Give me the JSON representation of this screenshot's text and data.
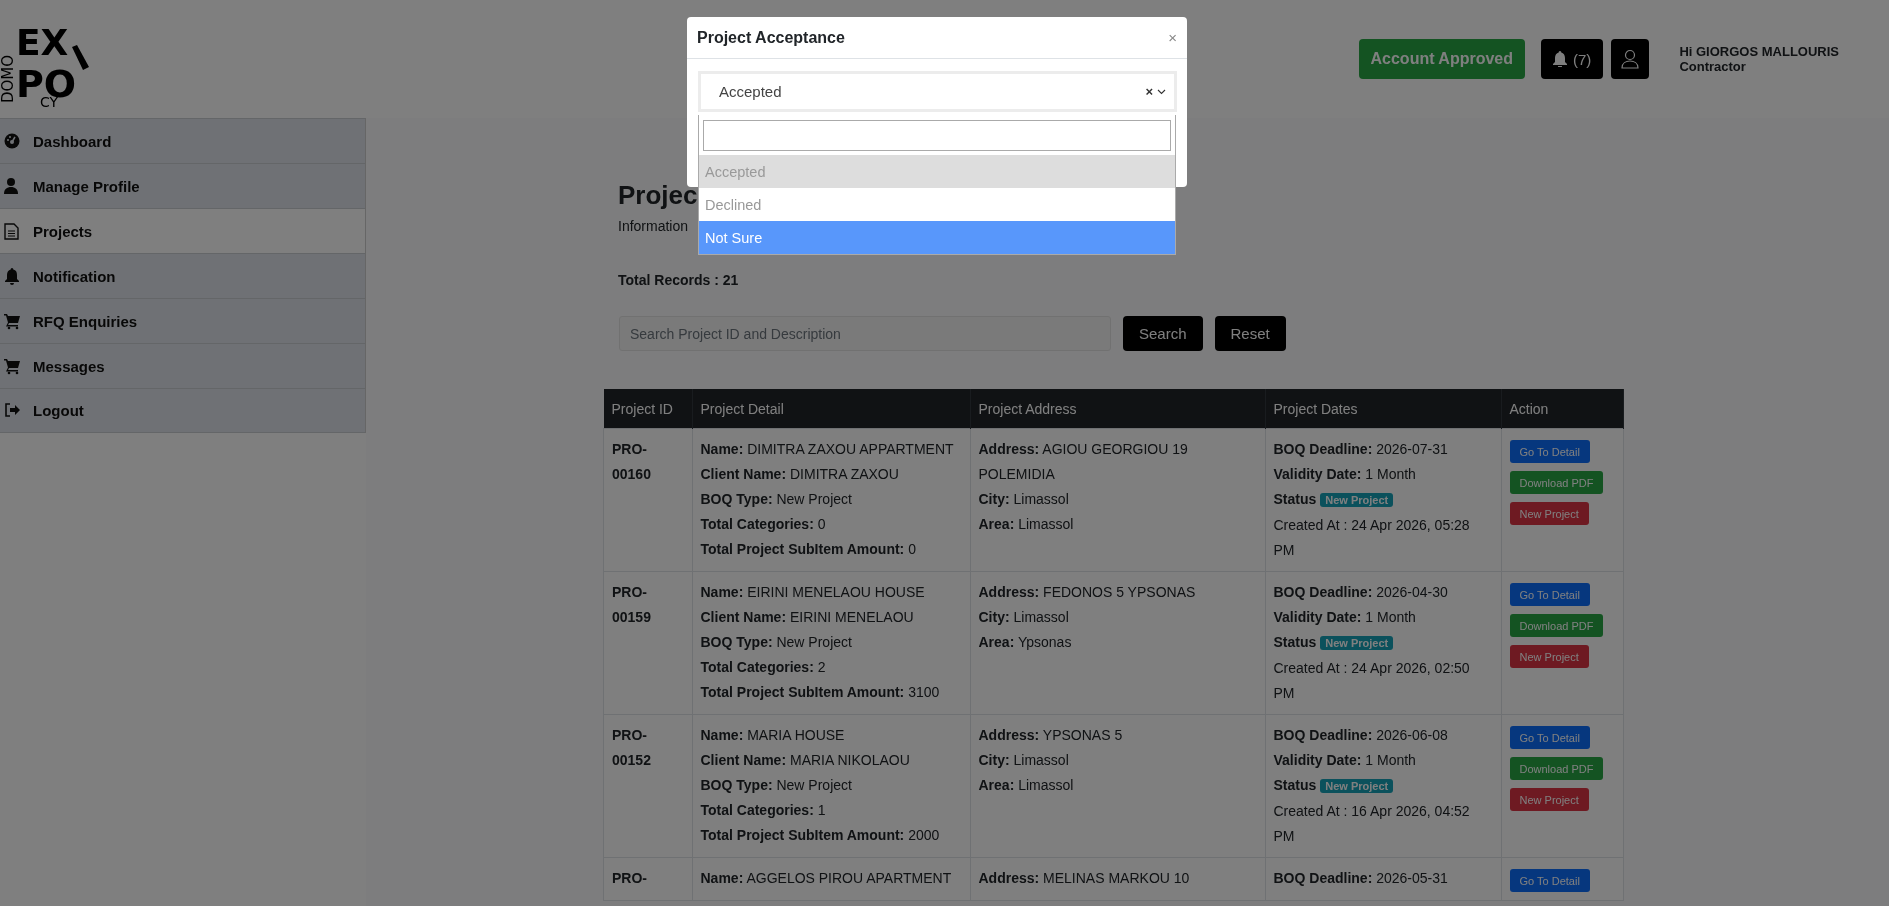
{
  "logo": {
    "vertical": "DOMO",
    "top": "EX",
    "bottom": "PO",
    "small": "CY"
  },
  "header": {
    "account_status": "Account Approved",
    "notifications": "(7)",
    "greeting": "Hi GIORGOS MALLOURIS",
    "role": "Contractor"
  },
  "sidebar": {
    "items": [
      {
        "label": "Dashboard",
        "selected": false
      },
      {
        "label": "Manage Profile",
        "selected": false
      },
      {
        "label": "Projects",
        "selected": true
      },
      {
        "label": "Notification",
        "selected": false
      },
      {
        "label": "RFQ Enquiries",
        "selected": false
      },
      {
        "label": "Messages",
        "selected": false
      },
      {
        "label": "Logout",
        "selected": false
      }
    ]
  },
  "page": {
    "title": "Projec",
    "subtitle": "Information",
    "total_records": "Total Records : 21"
  },
  "search": {
    "placeholder": "Search Project ID and Description",
    "buttons": [
      "Search",
      "Reset"
    ]
  },
  "table": {
    "columns": [
      "Project ID",
      "Project Detail",
      "Project Address",
      "Project Dates",
      "Action"
    ],
    "rows": [
      {
        "id": "PRO-00160",
        "detail": [
          {
            "label": "Name:",
            "value": "DIMITRA ZAXOU APPARTMENT"
          },
          {
            "label": "Client Name:",
            "value": "DIMITRA ZAXOU"
          },
          {
            "label": "BOQ Type:",
            "value": "New Project"
          },
          {
            "label": "Total Categories:",
            "value": "0"
          },
          {
            "label": "Total Project SubItem Amount:",
            "value": "0"
          }
        ],
        "address": [
          {
            "label": "Address:",
            "value": "AGIOU GEORGIOU 19 POLEMIDIA"
          },
          {
            "label": "City:",
            "value": "Limassol"
          },
          {
            "label": "Area:",
            "value": "Limassol"
          }
        ],
        "dates": [
          {
            "kind": "field",
            "label": "BOQ Deadline:",
            "value": "2026-07-31"
          },
          {
            "kind": "field",
            "label": "Validity Date:",
            "value": "1 Month"
          },
          {
            "kind": "status",
            "label": "Status",
            "value": "New Project"
          },
          {
            "kind": "text",
            "value": "Created At : 24 Apr 2026, 05:28 PM"
          }
        ],
        "actions": [
          {
            "kind": "primary",
            "label": "Go To Detail"
          },
          {
            "kind": "success",
            "label": "Download PDF"
          },
          {
            "kind": "danger",
            "label": "New Project"
          }
        ]
      },
      {
        "id": "PRO-00159",
        "detail": [
          {
            "label": "Name:",
            "value": "EIRINI MENELAOU HOUSE"
          },
          {
            "label": "Client Name:",
            "value": "EIRINI MENELAOU"
          },
          {
            "label": "BOQ Type:",
            "value": "New Project"
          },
          {
            "label": "Total Categories:",
            "value": "2"
          },
          {
            "label": "Total Project SubItem Amount:",
            "value": "3100"
          }
        ],
        "address": [
          {
            "label": "Address:",
            "value": "FEDONOS 5 YPSONAS"
          },
          {
            "label": "City:",
            "value": "Limassol"
          },
          {
            "label": "Area:",
            "value": "Ypsonas"
          }
        ],
        "dates": [
          {
            "kind": "field",
            "label": "BOQ Deadline:",
            "value": "2026-04-30"
          },
          {
            "kind": "field",
            "label": "Validity Date:",
            "value": "1 Month"
          },
          {
            "kind": "status",
            "label": "Status",
            "value": "New Project"
          },
          {
            "kind": "text",
            "value": "Created At : 24 Apr 2026, 02:50 PM"
          }
        ],
        "actions": [
          {
            "kind": "primary",
            "label": "Go To Detail"
          },
          {
            "kind": "success",
            "label": "Download PDF"
          },
          {
            "kind": "danger",
            "label": "New Project"
          }
        ]
      },
      {
        "id": "PRO-00152",
        "detail": [
          {
            "label": "Name:",
            "value": "MARIA HOUSE"
          },
          {
            "label": "Client Name:",
            "value": "MARIA NIKOLAOU"
          },
          {
            "label": "BOQ Type:",
            "value": "New Project"
          },
          {
            "label": "Total Categories:",
            "value": "1"
          },
          {
            "label": "Total Project SubItem Amount:",
            "value": "2000"
          }
        ],
        "address": [
          {
            "label": "Address:",
            "value": "YPSONAS 5"
          },
          {
            "label": "City:",
            "value": "Limassol"
          },
          {
            "label": "Area:",
            "value": "Limassol"
          }
        ],
        "dates": [
          {
            "kind": "field",
            "label": "BOQ Deadline:",
            "value": "2026-06-08"
          },
          {
            "kind": "field",
            "label": "Validity Date:",
            "value": "1 Month"
          },
          {
            "kind": "status",
            "label": "Status",
            "value": "New Project"
          },
          {
            "kind": "text",
            "value": "Created At : 16 Apr 2026, 04:52 PM"
          }
        ],
        "actions": [
          {
            "kind": "primary",
            "label": "Go To Detail"
          },
          {
            "kind": "success",
            "label": "Download PDF"
          },
          {
            "kind": "danger",
            "label": "New Project"
          }
        ]
      },
      {
        "id": "PRO-",
        "detail": [
          {
            "label": "Name:",
            "value": "AGGELOS PIROU APARTMENT"
          }
        ],
        "address": [
          {
            "label": "Address:",
            "value": "MELINAS MARKOU 10"
          }
        ],
        "dates": [
          {
            "kind": "field",
            "label": "BOQ Deadline:",
            "value": "2026-05-31"
          }
        ],
        "actions": [
          {
            "kind": "primary",
            "label": "Go To Detail"
          }
        ]
      }
    ]
  },
  "modal": {
    "title": "Project Acceptance",
    "close": "×",
    "select": {
      "value": "Accepted",
      "clear": "×"
    },
    "options": [
      {
        "label": "Accepted",
        "selected": true,
        "highlighted": false
      },
      {
        "label": "Declined",
        "selected": false,
        "highlighted": false
      },
      {
        "label": "Not Sure",
        "selected": false,
        "highlighted": true
      }
    ]
  }
}
